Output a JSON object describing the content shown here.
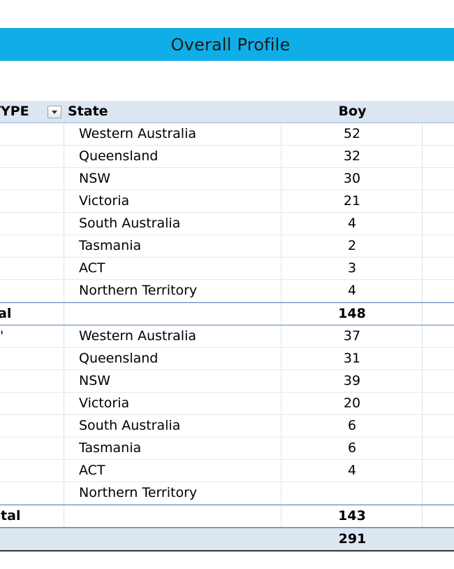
{
  "title": "Overall Profile",
  "header": {
    "type_label": "TYPE",
    "state_label": "State",
    "boy_label": "Boy"
  },
  "groups": [
    {
      "rows": [
        {
          "state": "Western Australia",
          "boy": "52"
        },
        {
          "state": "Queensland",
          "boy": "32"
        },
        {
          "state": "NSW",
          "boy": "30"
        },
        {
          "state": "Victoria",
          "boy": "21"
        },
        {
          "state": "South Australia",
          "boy": "4"
        },
        {
          "state": "Tasmania",
          "boy": "2"
        },
        {
          "state": "ACT",
          "boy": "3"
        },
        {
          "state": "Northern Territory",
          "boy": "4"
        }
      ],
      "total_label": "tal",
      "total_boy": "148"
    },
    {
      "type_fragment": "'",
      "rows": [
        {
          "state": "Western Australia",
          "boy": "37"
        },
        {
          "state": "Queensland",
          "boy": "31"
        },
        {
          "state": "NSW",
          "boy": "39"
        },
        {
          "state": "Victoria",
          "boy": "20"
        },
        {
          "state": "South Australia",
          "boy": "6"
        },
        {
          "state": "Tasmania",
          "boy": "6"
        },
        {
          "state": "ACT",
          "boy": "4"
        },
        {
          "state": "Northern Territory",
          "boy": ""
        }
      ],
      "total_label": "otal",
      "total_boy": "143"
    }
  ],
  "grand_total_boy": "291",
  "colors": {
    "banner": "#0faee8",
    "header_bg": "#dce6f1",
    "subtotal_line": "#5b87b8"
  }
}
